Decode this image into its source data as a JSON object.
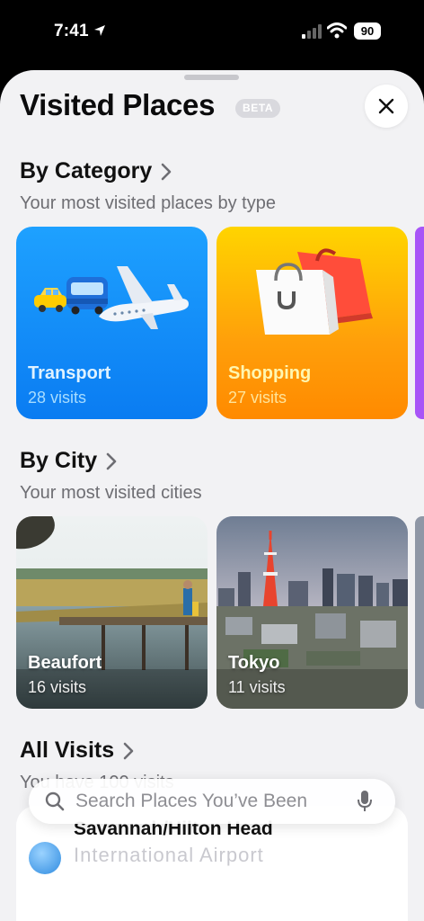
{
  "status_bar": {
    "time": "7:41",
    "battery": "90"
  },
  "sheet": {
    "title": "Visited Places",
    "badge": "BETA"
  },
  "sections": {
    "category": {
      "title": "By Category",
      "subtitle": "Your most visited places by type",
      "cards": [
        {
          "label": "Transport",
          "count": "28 visits"
        },
        {
          "label": "Shopping",
          "count": "27 visits"
        }
      ]
    },
    "city": {
      "title": "By City",
      "subtitle": "Your most visited cities",
      "cards": [
        {
          "label": "Beaufort",
          "count": "16 visits"
        },
        {
          "label": "Tokyo",
          "count": "11 visits"
        }
      ]
    },
    "all": {
      "title": "All Visits",
      "subtitle": "You have 100 visits",
      "first_item": "Savannah/Hilton Head",
      "first_item_sub": "International Airport"
    }
  },
  "search": {
    "placeholder": "Search Places You’ve Been"
  },
  "colors": {
    "transport": "#0a84ff",
    "shopping": "#ff9f0a",
    "peek_category": "#a855f7"
  },
  "icons": [
    "location-arrow-icon",
    "signal-icon",
    "wifi-icon",
    "close-icon",
    "chevron-right-icon",
    "search-icon",
    "microphone-icon"
  ]
}
